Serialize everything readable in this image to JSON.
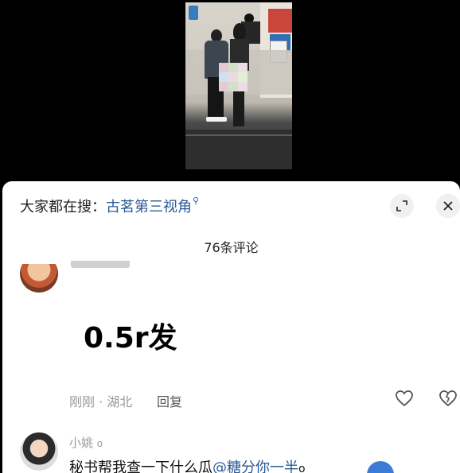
{
  "video": {
    "description_icon": "video-thumbnail"
  },
  "sheet": {
    "search": {
      "label": "大家都在搜：",
      "term": "古茗第三视角",
      "search_icon": "search-icon"
    },
    "expand_icon": "expand-icon",
    "close_icon": "close-icon",
    "comment_count": "76条评论",
    "comments": [
      {
        "avatar_icon": "avatar",
        "text": "0.5r发",
        "meta": "刚刚 · 湖北",
        "reply": "回复",
        "like_icon": "heart-icon",
        "dislike_icon": "broken-heart-icon"
      },
      {
        "avatar_icon": "avatar",
        "username": "小姚",
        "username_suffix": "o",
        "text": "秘书帮我查一下什么瓜",
        "mention": "@糖分你一半",
        "mention_suffix": "o"
      }
    ]
  }
}
